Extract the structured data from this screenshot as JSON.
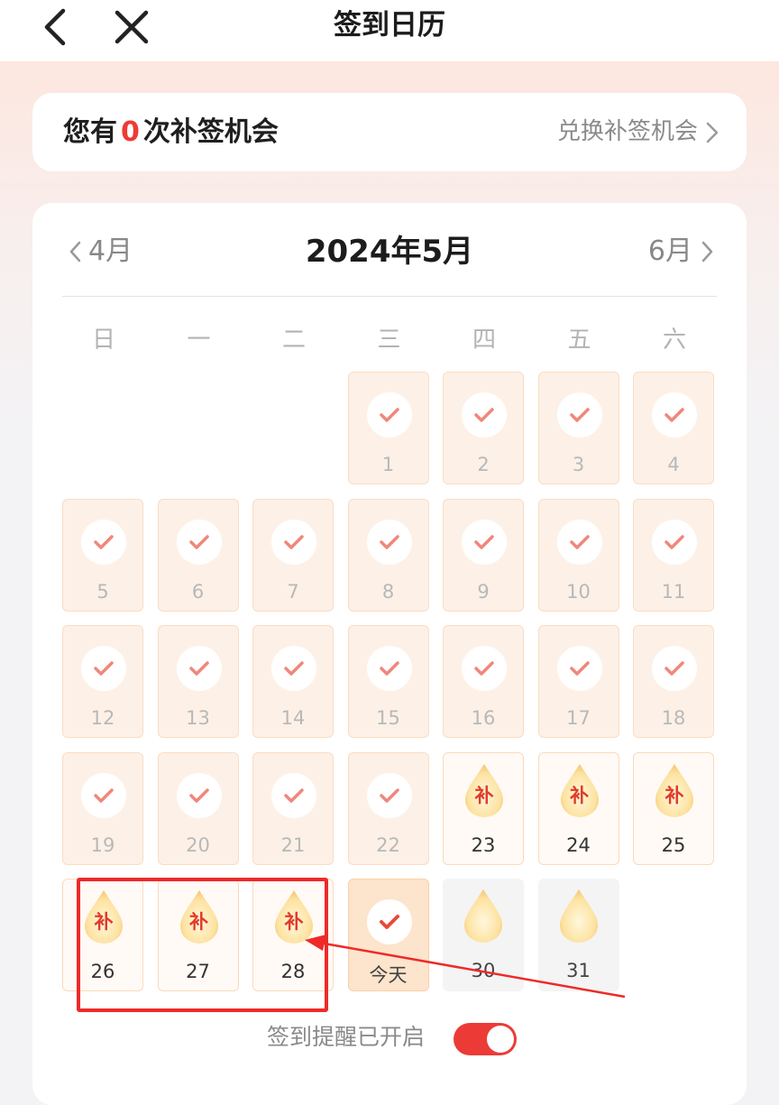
{
  "header": {
    "title": "签到日历"
  },
  "summary": {
    "text_before": "您有",
    "count": "0",
    "text_after": "次补签机会",
    "exchange_label": "兑换补签机会"
  },
  "calendar": {
    "prev_month": "4月",
    "title": "2024年5月",
    "next_month": "6月",
    "weekdays": [
      "日",
      "一",
      "二",
      "三",
      "四",
      "五",
      "六"
    ],
    "makeup_label": "补",
    "today_label": "今天",
    "days": [
      {
        "label": "1",
        "state": "signed"
      },
      {
        "label": "2",
        "state": "signed"
      },
      {
        "label": "3",
        "state": "signed"
      },
      {
        "label": "4",
        "state": "signed"
      },
      {
        "label": "5",
        "state": "signed"
      },
      {
        "label": "6",
        "state": "signed"
      },
      {
        "label": "7",
        "state": "signed"
      },
      {
        "label": "8",
        "state": "signed"
      },
      {
        "label": "9",
        "state": "signed"
      },
      {
        "label": "10",
        "state": "signed"
      },
      {
        "label": "11",
        "state": "signed"
      },
      {
        "label": "12",
        "state": "signed"
      },
      {
        "label": "13",
        "state": "signed"
      },
      {
        "label": "14",
        "state": "signed"
      },
      {
        "label": "15",
        "state": "signed"
      },
      {
        "label": "16",
        "state": "signed"
      },
      {
        "label": "17",
        "state": "signed"
      },
      {
        "label": "18",
        "state": "signed"
      },
      {
        "label": "19",
        "state": "signed"
      },
      {
        "label": "20",
        "state": "signed"
      },
      {
        "label": "21",
        "state": "signed"
      },
      {
        "label": "22",
        "state": "signed"
      },
      {
        "label": "23",
        "state": "makeup"
      },
      {
        "label": "24",
        "state": "makeup"
      },
      {
        "label": "25",
        "state": "makeup"
      },
      {
        "label": "26",
        "state": "makeup"
      },
      {
        "label": "27",
        "state": "makeup"
      },
      {
        "label": "28",
        "state": "makeup"
      },
      {
        "label": "今天",
        "state": "today"
      },
      {
        "label": "30",
        "state": "future"
      },
      {
        "label": "31",
        "state": "future"
      }
    ]
  },
  "reminder": {
    "label": "签到提醒已开启",
    "enabled": true
  },
  "colors": {
    "accent": "#ec3b36",
    "check": "#f0877a",
    "today_check": "#e84a3b",
    "signed_bg": "#fdf1e7",
    "highlight": "#ee2a28"
  },
  "icons": {
    "back": "chevron-left-icon",
    "close": "close-icon",
    "check": "check-icon",
    "drop": "drop-icon"
  }
}
